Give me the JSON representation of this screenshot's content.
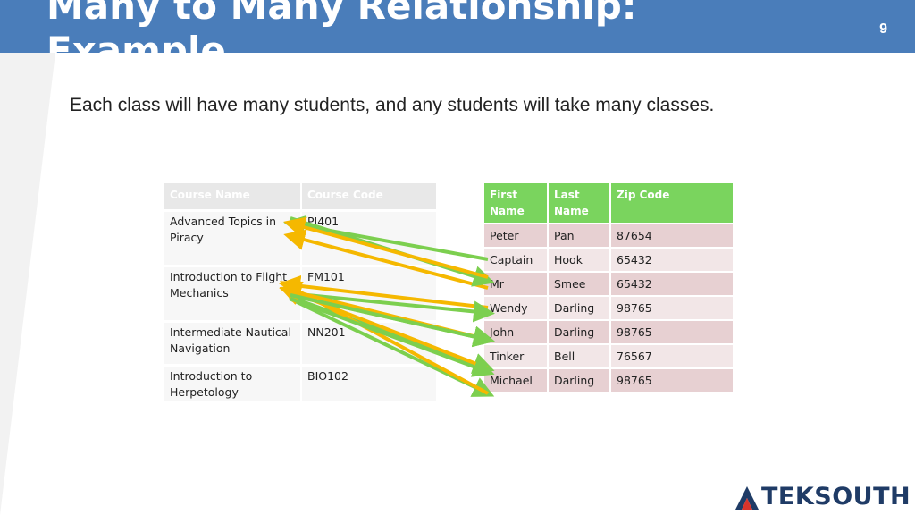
{
  "slide": {
    "title_line1": "Many to Many Relationship:",
    "title_line2": "Example",
    "page_number": "9",
    "body_text": "Each class will have many students, and any students will take many classes."
  },
  "course_table": {
    "headers": [
      "Course Name",
      "Course Code"
    ],
    "rows": [
      [
        "Advanced Topics in Piracy",
        "PI401"
      ],
      [
        "Introduction to Flight Mechanics",
        "FM101"
      ],
      [
        "Intermediate Nautical Navigation",
        "NN201"
      ],
      [
        "Introduction to Herpetology",
        "BIO102"
      ]
    ]
  },
  "student_table": {
    "headers": [
      "First Name",
      "Last Name",
      "Zip Code"
    ],
    "rows": [
      [
        "Peter",
        "Pan",
        "87654"
      ],
      [
        "Captain",
        "Hook",
        "65432"
      ],
      [
        "Mr",
        "Smee",
        "65432"
      ],
      [
        "Wendy",
        "Darling",
        "98765"
      ],
      [
        "John",
        "Darling",
        "98765"
      ],
      [
        "Tinker",
        "Bell",
        "76567"
      ],
      [
        "Michael",
        "Darling",
        "98765"
      ]
    ]
  },
  "colors": {
    "header_band": "#4a7dba",
    "student_header": "#7ad45e",
    "arrow_green": "#7ccf4f",
    "arrow_orange": "#f5b800",
    "logo": "#1f3b66",
    "logo_accent": "#d9342b"
  },
  "logo": {
    "text": "TEKSOUTH",
    "icon": "teksouth-a-icon"
  },
  "arrows": [
    {
      "from": "Captain",
      "to": "Advanced Topics in Piracy",
      "color": "green"
    },
    {
      "from": "Mr",
      "to": "Advanced Topics in Piracy",
      "color": "orange"
    },
    {
      "from": "Advanced Topics in Piracy",
      "to": "Mr",
      "color": "green"
    },
    {
      "from": "Captain",
      "to": "Advanced Topics in Piracy",
      "color": "orange"
    },
    {
      "from": "Wendy",
      "to": "Introduction to Flight Mechanics",
      "color": "orange"
    },
    {
      "from": "Introduction to Flight Mechanics",
      "to": "Wendy",
      "color": "green"
    },
    {
      "from": "Introduction to Flight Mechanics",
      "to": "John",
      "color": "green"
    },
    {
      "from": "Introduction to Flight Mechanics",
      "to": "Tinker",
      "color": "green"
    },
    {
      "from": "Introduction to Flight Mechanics",
      "to": "Michael",
      "color": "green"
    },
    {
      "from": "John",
      "to": "Introduction to Flight Mechanics",
      "color": "orange"
    },
    {
      "from": "Tinker",
      "to": "Introduction to Flight Mechanics",
      "color": "orange"
    },
    {
      "from": "Michael",
      "to": "Introduction to Flight Mechanics",
      "color": "orange"
    },
    {
      "from": "Intermediate Nautical Navigation",
      "to": "John",
      "color": "green"
    },
    {
      "from": "Intermediate Nautical Navigation",
      "to": "Tinker",
      "color": "green"
    }
  ]
}
